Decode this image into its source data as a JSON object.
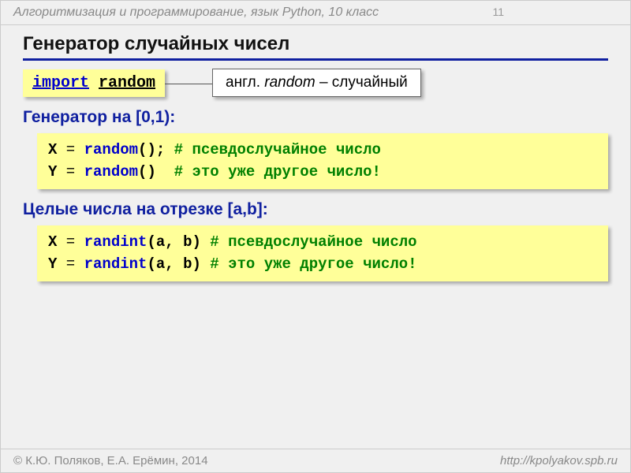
{
  "header": {
    "course": "Алгоритмизация и программирование, язык Python, 10 класс",
    "page_number": "11"
  },
  "title": "Генератор случайных чисел",
  "import_code": {
    "keyword": "import",
    "module": "random"
  },
  "callout": {
    "prefix": "англ. ",
    "word": "random",
    "suffix": " – случайный"
  },
  "section1": {
    "heading": "Генератор на [0,1):",
    "lines": [
      {
        "v": "X",
        "eq": " = ",
        "fn": "random",
        "p": "();",
        "sp": " ",
        "c": "# псевдослучайное число"
      },
      {
        "v": "Y",
        "eq": " = ",
        "fn": "random",
        "p": "()",
        "sp": "  ",
        "c": "# это уже другое число!"
      }
    ]
  },
  "section2": {
    "heading": "Целые числа на отрезке [a,b]:",
    "lines": [
      {
        "v": "X",
        "eq": " = ",
        "fn": "randint",
        "p1": "(",
        "a": "a, b",
        "p2": ")",
        "sp": " ",
        "c": "# псевдослучайное число"
      },
      {
        "v": "Y",
        "eq": " = ",
        "fn": "randint",
        "p1": "(",
        "a": "a, b",
        "p2": ")",
        "sp": " ",
        "c": "# это уже другое число!"
      }
    ]
  },
  "footer": {
    "copyright": "© К.Ю. Поляков, Е.А. Ерёмин, 2014",
    "url": "http://kpolyakov.spb.ru"
  }
}
